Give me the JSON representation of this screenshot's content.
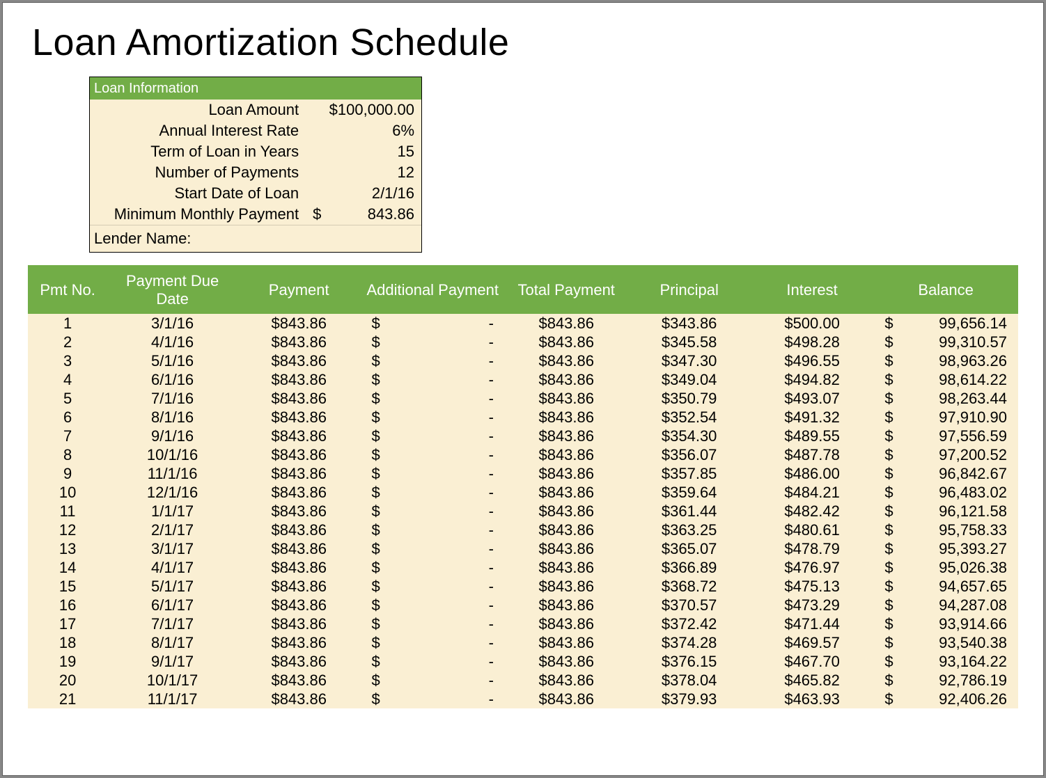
{
  "title": "Loan Amortization Schedule",
  "info": {
    "header": "Loan Information",
    "rows": {
      "loan_amount": {
        "label": "Loan Amount",
        "value": "$100,000.00"
      },
      "annual_rate": {
        "label": "Annual Interest Rate",
        "value": "6%"
      },
      "term_years": {
        "label": "Term of Loan in Years",
        "value": "15"
      },
      "num_payments": {
        "label": "Number of Payments",
        "value": "12"
      },
      "start_date": {
        "label": "Start Date of Loan",
        "value": "2/1/16"
      },
      "min_payment": {
        "label": "Minimum Monthly Payment",
        "symbol": "$",
        "value": "843.86"
      }
    },
    "lender_label": "Lender Name:"
  },
  "schedule": {
    "headers": {
      "pmt_no": "Pmt No.",
      "due_date": "Payment Due Date",
      "payment": "Payment",
      "additional": "Additional Payment",
      "total": "Total Payment",
      "principal": "Principal",
      "interest": "Interest",
      "balance": "Balance"
    },
    "rows": [
      {
        "no": "1",
        "date": "3/1/16",
        "payment": "$843.86",
        "addl_sym": "$",
        "addl_val": "-",
        "total": "$843.86",
        "principal": "$343.86",
        "interest": "$500.00",
        "bal_sym": "$",
        "bal_val": "99,656.14"
      },
      {
        "no": "2",
        "date": "4/1/16",
        "payment": "$843.86",
        "addl_sym": "$",
        "addl_val": "-",
        "total": "$843.86",
        "principal": "$345.58",
        "interest": "$498.28",
        "bal_sym": "$",
        "bal_val": "99,310.57"
      },
      {
        "no": "3",
        "date": "5/1/16",
        "payment": "$843.86",
        "addl_sym": "$",
        "addl_val": "-",
        "total": "$843.86",
        "principal": "$347.30",
        "interest": "$496.55",
        "bal_sym": "$",
        "bal_val": "98,963.26"
      },
      {
        "no": "4",
        "date": "6/1/16",
        "payment": "$843.86",
        "addl_sym": "$",
        "addl_val": "-",
        "total": "$843.86",
        "principal": "$349.04",
        "interest": "$494.82",
        "bal_sym": "$",
        "bal_val": "98,614.22"
      },
      {
        "no": "5",
        "date": "7/1/16",
        "payment": "$843.86",
        "addl_sym": "$",
        "addl_val": "-",
        "total": "$843.86",
        "principal": "$350.79",
        "interest": "$493.07",
        "bal_sym": "$",
        "bal_val": "98,263.44"
      },
      {
        "no": "6",
        "date": "8/1/16",
        "payment": "$843.86",
        "addl_sym": "$",
        "addl_val": "-",
        "total": "$843.86",
        "principal": "$352.54",
        "interest": "$491.32",
        "bal_sym": "$",
        "bal_val": "97,910.90"
      },
      {
        "no": "7",
        "date": "9/1/16",
        "payment": "$843.86",
        "addl_sym": "$",
        "addl_val": "-",
        "total": "$843.86",
        "principal": "$354.30",
        "interest": "$489.55",
        "bal_sym": "$",
        "bal_val": "97,556.59"
      },
      {
        "no": "8",
        "date": "10/1/16",
        "payment": "$843.86",
        "addl_sym": "$",
        "addl_val": "-",
        "total": "$843.86",
        "principal": "$356.07",
        "interest": "$487.78",
        "bal_sym": "$",
        "bal_val": "97,200.52"
      },
      {
        "no": "9",
        "date": "11/1/16",
        "payment": "$843.86",
        "addl_sym": "$",
        "addl_val": "-",
        "total": "$843.86",
        "principal": "$357.85",
        "interest": "$486.00",
        "bal_sym": "$",
        "bal_val": "96,842.67"
      },
      {
        "no": "10",
        "date": "12/1/16",
        "payment": "$843.86",
        "addl_sym": "$",
        "addl_val": "-",
        "total": "$843.86",
        "principal": "$359.64",
        "interest": "$484.21",
        "bal_sym": "$",
        "bal_val": "96,483.02"
      },
      {
        "no": "11",
        "date": "1/1/17",
        "payment": "$843.86",
        "addl_sym": "$",
        "addl_val": "-",
        "total": "$843.86",
        "principal": "$361.44",
        "interest": "$482.42",
        "bal_sym": "$",
        "bal_val": "96,121.58"
      },
      {
        "no": "12",
        "date": "2/1/17",
        "payment": "$843.86",
        "addl_sym": "$",
        "addl_val": "-",
        "total": "$843.86",
        "principal": "$363.25",
        "interest": "$480.61",
        "bal_sym": "$",
        "bal_val": "95,758.33"
      },
      {
        "no": "13",
        "date": "3/1/17",
        "payment": "$843.86",
        "addl_sym": "$",
        "addl_val": "-",
        "total": "$843.86",
        "principal": "$365.07",
        "interest": "$478.79",
        "bal_sym": "$",
        "bal_val": "95,393.27"
      },
      {
        "no": "14",
        "date": "4/1/17",
        "payment": "$843.86",
        "addl_sym": "$",
        "addl_val": "-",
        "total": "$843.86",
        "principal": "$366.89",
        "interest": "$476.97",
        "bal_sym": "$",
        "bal_val": "95,026.38"
      },
      {
        "no": "15",
        "date": "5/1/17",
        "payment": "$843.86",
        "addl_sym": "$",
        "addl_val": "-",
        "total": "$843.86",
        "principal": "$368.72",
        "interest": "$475.13",
        "bal_sym": "$",
        "bal_val": "94,657.65"
      },
      {
        "no": "16",
        "date": "6/1/17",
        "payment": "$843.86",
        "addl_sym": "$",
        "addl_val": "-",
        "total": "$843.86",
        "principal": "$370.57",
        "interest": "$473.29",
        "bal_sym": "$",
        "bal_val": "94,287.08"
      },
      {
        "no": "17",
        "date": "7/1/17",
        "payment": "$843.86",
        "addl_sym": "$",
        "addl_val": "-",
        "total": "$843.86",
        "principal": "$372.42",
        "interest": "$471.44",
        "bal_sym": "$",
        "bal_val": "93,914.66"
      },
      {
        "no": "18",
        "date": "8/1/17",
        "payment": "$843.86",
        "addl_sym": "$",
        "addl_val": "-",
        "total": "$843.86",
        "principal": "$374.28",
        "interest": "$469.57",
        "bal_sym": "$",
        "bal_val": "93,540.38"
      },
      {
        "no": "19",
        "date": "9/1/17",
        "payment": "$843.86",
        "addl_sym": "$",
        "addl_val": "-",
        "total": "$843.86",
        "principal": "$376.15",
        "interest": "$467.70",
        "bal_sym": "$",
        "bal_val": "93,164.22"
      },
      {
        "no": "20",
        "date": "10/1/17",
        "payment": "$843.86",
        "addl_sym": "$",
        "addl_val": "-",
        "total": "$843.86",
        "principal": "$378.04",
        "interest": "$465.82",
        "bal_sym": "$",
        "bal_val": "92,786.19"
      },
      {
        "no": "21",
        "date": "11/1/17",
        "payment": "$843.86",
        "addl_sym": "$",
        "addl_val": "-",
        "total": "$843.86",
        "principal": "$379.93",
        "interest": "$463.93",
        "bal_sym": "$",
        "bal_val": "92,406.26"
      }
    ]
  }
}
